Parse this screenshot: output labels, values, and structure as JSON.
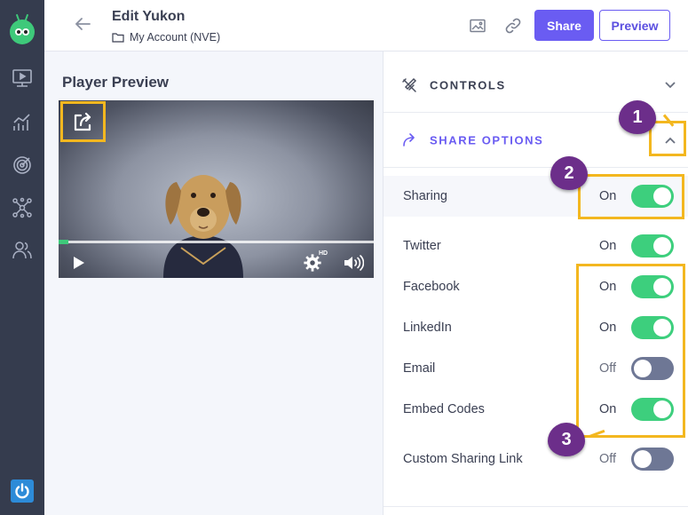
{
  "header": {
    "title": "Edit Yukon",
    "breadcrumb": "My Account (NVE)",
    "share_label": "Share",
    "preview_label": "Preview"
  },
  "preview": {
    "title": "Player Preview",
    "hd_badge": "HD",
    "progress_fraction": 0.03
  },
  "panel": {
    "controls_label": "CONTROLS",
    "share_options_label": "SHARE OPTIONS",
    "rows": [
      {
        "name": "Sharing",
        "state": "On"
      },
      {
        "name": "Twitter",
        "state": "On"
      },
      {
        "name": "Facebook",
        "state": "On"
      },
      {
        "name": "LinkedIn",
        "state": "On"
      },
      {
        "name": "Email",
        "state": "Off"
      },
      {
        "name": "Embed Codes",
        "state": "On"
      },
      {
        "name": "Custom Sharing Link",
        "state": "Off"
      }
    ]
  },
  "annotations": {
    "badge1": "1",
    "badge2": "2",
    "badge3": "3"
  },
  "colors": {
    "accent": "#6a5cf2",
    "toggle_on": "#3dcf7d",
    "toggle_off": "#6e7795",
    "highlight": "#f3b71f",
    "badge": "#6c2e8a",
    "sidebar": "#353c4e"
  }
}
